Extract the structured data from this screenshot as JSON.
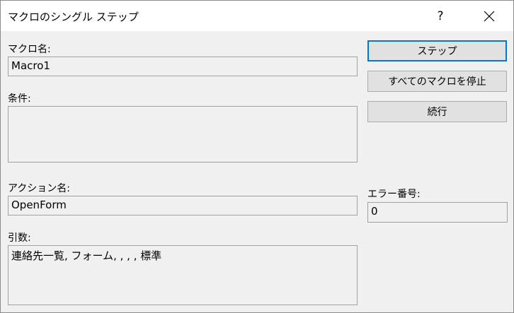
{
  "window": {
    "title": "マクロのシングル ステップ",
    "help_label": "?"
  },
  "form": {
    "macro_name_label": "マクロ名:",
    "macro_name_value": "Macro1",
    "condition_label": "条件:",
    "condition_value": "",
    "action_name_label": "アクション名:",
    "action_name_value": "OpenForm",
    "arguments_label": "引数:",
    "arguments_value": "連絡先一覧, フォーム, , , , 標準",
    "error_number_label": "エラー番号:",
    "error_number_value": "0"
  },
  "buttons": {
    "step_label": "ステップ",
    "stop_all_label": "すべてのマクロを停止",
    "continue_label": "続行"
  },
  "colors": {
    "accent": "#0078d7",
    "dialog_background": "#f0f0f0",
    "titlebar_background": "#ffffff"
  }
}
